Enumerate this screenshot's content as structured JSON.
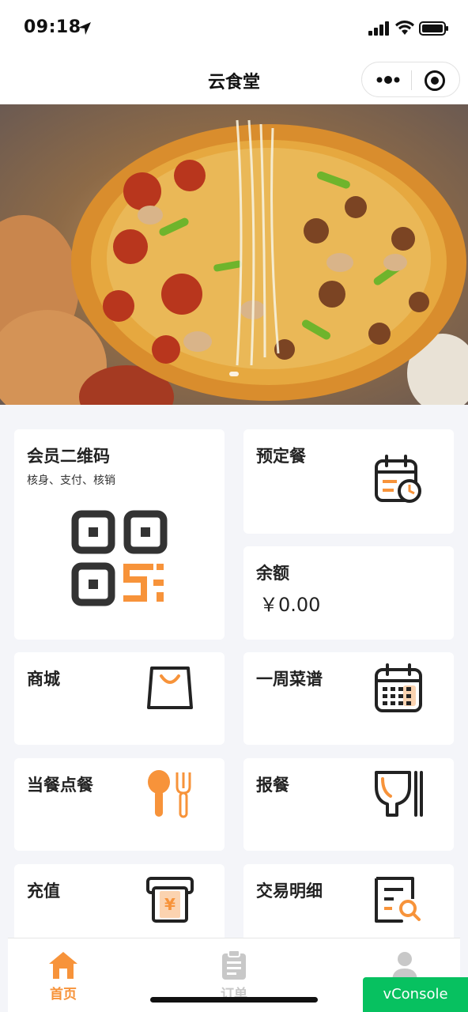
{
  "status_bar": {
    "time": "09:18"
  },
  "nav": {
    "title": "云食堂"
  },
  "colors": {
    "accent": "#f7933a",
    "dark": "#333333",
    "vconsole": "#07c160"
  },
  "cards": {
    "member_qr": {
      "title": "会员二维码",
      "subtitle": "核身、支付、核销",
      "icon": "qr-code-icon"
    },
    "reserve": {
      "title": "预定餐",
      "icon": "calendar-clock-icon"
    },
    "balance": {
      "title": "余额",
      "value": "￥0.00"
    },
    "mall": {
      "title": "商城",
      "icon": "shopping-bag-icon"
    },
    "weekly_menu": {
      "title": "一周菜谱",
      "icon": "calendar-grid-icon"
    },
    "order_now": {
      "title": "当餐点餐",
      "icon": "spoon-fork-icon"
    },
    "report_meal": {
      "title": "报餐",
      "icon": "bowl-chopsticks-icon"
    },
    "recharge": {
      "title": "充值",
      "icon": "cash-card-icon"
    },
    "transactions": {
      "title": "交易明细",
      "icon": "document-search-icon"
    }
  },
  "tabs": [
    {
      "label": "首页",
      "icon": "home-icon",
      "active": true
    },
    {
      "label": "订单",
      "icon": "clipboard-icon",
      "active": false
    },
    {
      "label": "",
      "icon": "user-icon",
      "active": false
    }
  ],
  "vconsole": {
    "label": "vConsole"
  }
}
